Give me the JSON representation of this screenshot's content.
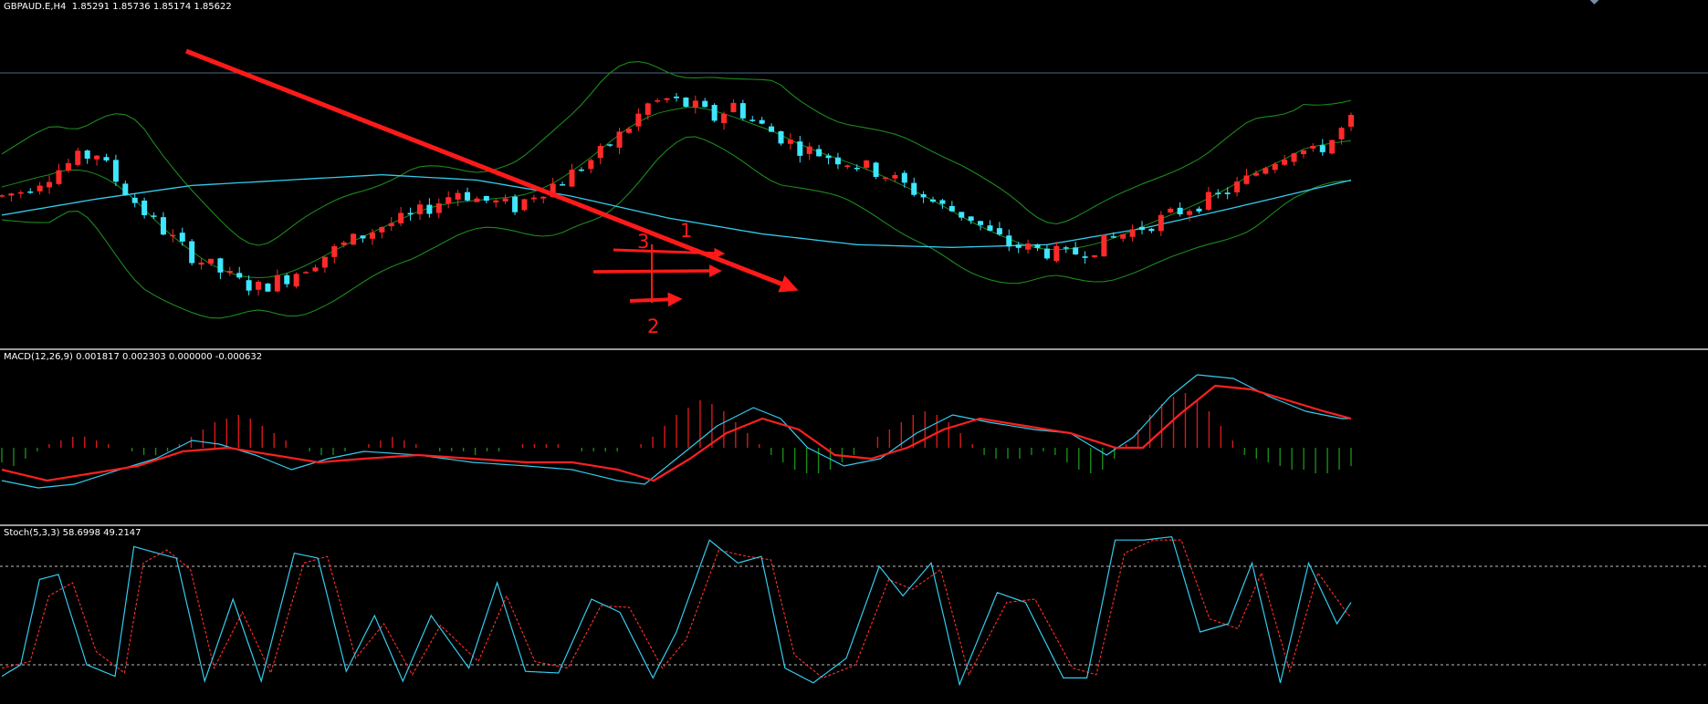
{
  "main_pane": {
    "label": "GBPAUD.E,H4  1.85291 1.85736 1.85174 1.85622",
    "annotations": [
      "1",
      "2",
      "3"
    ]
  },
  "macd_pane": {
    "label": "MACD(12,26,9) 0.001817 0.002303 0.000000 -0.000632"
  },
  "stoch_pane": {
    "label": "Stoch(5,3,3) 58.6998 49.2147",
    "levels": [
      80,
      20
    ]
  },
  "colors": {
    "bull": "#ff2a2a",
    "bear": "#3ee6ff",
    "ma": "#33ccee",
    "bands": "#1d8a1d",
    "trendline": "#ff1a1a",
    "macd_pos": "#d41a1a",
    "macd_neg": "#1a8a1a",
    "signal": "#ff2020",
    "stoch_main": "#33ccee",
    "stoch_signal": "#ff3030"
  },
  "chart_data": [
    {
      "type": "candlestick",
      "title": "GBPAUD.E,H4  1.85291 1.85736 1.85174 1.85622",
      "symbol": "GBPAUD.E",
      "timeframe": "H4",
      "last": {
        "open": 1.85291,
        "high": 1.85736,
        "low": 1.85174,
        "close": 1.85622
      },
      "close_path": [
        [
          0,
          0.44
        ],
        [
          4,
          0.46
        ],
        [
          10,
          0.52
        ],
        [
          16,
          0.58
        ],
        [
          20,
          0.6
        ],
        [
          24,
          0.5
        ],
        [
          30,
          0.38
        ],
        [
          36,
          0.28
        ],
        [
          40,
          0.22
        ],
        [
          46,
          0.16
        ],
        [
          50,
          0.12
        ],
        [
          54,
          0.1
        ],
        [
          60,
          0.14
        ],
        [
          66,
          0.2
        ],
        [
          72,
          0.26
        ],
        [
          80,
          0.33
        ],
        [
          86,
          0.36
        ],
        [
          90,
          0.4
        ],
        [
          96,
          0.46
        ],
        [
          100,
          0.43
        ],
        [
          108,
          0.4
        ],
        [
          112,
          0.45
        ],
        [
          118,
          0.5
        ],
        [
          126,
          0.6
        ],
        [
          132,
          0.7
        ],
        [
          136,
          0.78
        ],
        [
          140,
          0.8
        ],
        [
          146,
          0.77
        ],
        [
          150,
          0.73
        ],
        [
          154,
          0.78
        ],
        [
          158,
          0.72
        ],
        [
          162,
          0.68
        ],
        [
          168,
          0.62
        ],
        [
          174,
          0.59
        ],
        [
          180,
          0.56
        ],
        [
          186,
          0.52
        ],
        [
          192,
          0.46
        ],
        [
          198,
          0.4
        ],
        [
          204,
          0.36
        ],
        [
          208,
          0.3
        ],
        [
          212,
          0.26
        ],
        [
          218,
          0.24
        ],
        [
          224,
          0.22
        ],
        [
          230,
          0.25
        ],
        [
          236,
          0.3
        ],
        [
          242,
          0.34
        ],
        [
          250,
          0.4
        ],
        [
          256,
          0.44
        ],
        [
          262,
          0.5
        ],
        [
          266,
          0.56
        ],
        [
          272,
          0.62
        ],
        [
          276,
          0.6
        ],
        [
          280,
          0.65
        ],
        [
          284,
          0.72
        ]
      ],
      "moving_average": [
        [
          0,
          0.37
        ],
        [
          20,
          0.43
        ],
        [
          40,
          0.48
        ],
        [
          60,
          0.5
        ],
        [
          80,
          0.52
        ],
        [
          100,
          0.5
        ],
        [
          120,
          0.44
        ],
        [
          140,
          0.36
        ],
        [
          160,
          0.3
        ],
        [
          180,
          0.26
        ],
        [
          200,
          0.25
        ],
        [
          220,
          0.26
        ],
        [
          240,
          0.32
        ],
        [
          260,
          0.4
        ],
        [
          284,
          0.5
        ]
      ],
      "annotations": [
        "1",
        "2",
        "3"
      ]
    },
    {
      "type": "histogram+line",
      "title": "MACD(12,26,9) 0.001817 0.002303 0.000000 -0.000632",
      "params": [
        12,
        26,
        9
      ],
      "values": {
        "macd": 0.001817,
        "signal": 0.002303
      },
      "levels": [
        0.0,
        -0.000632
      ],
      "histogram": [
        -0.4,
        -0.5,
        -0.3,
        -0.1,
        0.1,
        0.2,
        0.3,
        0.3,
        0.2,
        0.1,
        0.0,
        -0.1,
        -0.2,
        -0.2,
        -0.1,
        0.1,
        0.3,
        0.5,
        0.7,
        0.8,
        0.9,
        0.8,
        0.6,
        0.4,
        0.2,
        0.0,
        -0.1,
        -0.2,
        -0.2,
        -0.1,
        0.0,
        0.1,
        0.2,
        0.3,
        0.2,
        0.1,
        0.0,
        -0.1,
        -0.1,
        -0.1,
        -0.2,
        -0.1,
        -0.1,
        0.0,
        0.1,
        0.1,
        0.1,
        0.1,
        0.0,
        -0.1,
        -0.1,
        -0.1,
        -0.1,
        0.0,
        0.1,
        0.3,
        0.6,
        0.9,
        1.1,
        1.3,
        1.2,
        1.0,
        0.7,
        0.4,
        0.1,
        -0.2,
        -0.4,
        -0.6,
        -0.7,
        -0.7,
        -0.6,
        -0.4,
        -0.2,
        0.0,
        0.3,
        0.5,
        0.7,
        0.9,
        1.0,
        0.9,
        0.7,
        0.4,
        0.1,
        -0.2,
        -0.3,
        -0.3,
        -0.3,
        -0.2,
        -0.1,
        -0.2,
        -0.4,
        -0.6,
        -0.7,
        -0.6,
        -0.3,
        0.1,
        0.5,
        0.9,
        1.2,
        1.4,
        1.5,
        1.3,
        1.0,
        0.6,
        0.2,
        -0.2,
        -0.3,
        -0.4,
        -0.5,
        -0.6,
        -0.6,
        -0.7,
        -0.7,
        -0.6,
        -0.5
      ],
      "macd_line": [
        [
          0,
          -0.9
        ],
        [
          8,
          -1.1
        ],
        [
          16,
          -1.0
        ],
        [
          26,
          -0.6
        ],
        [
          34,
          -0.3
        ],
        [
          42,
          0.2
        ],
        [
          48,
          0.1
        ],
        [
          56,
          -0.2
        ],
        [
          64,
          -0.6
        ],
        [
          72,
          -0.3
        ],
        [
          80,
          -0.1
        ],
        [
          92,
          -0.2
        ],
        [
          104,
          -0.4
        ],
        [
          116,
          -0.5
        ],
        [
          126,
          -0.6
        ],
        [
          136,
          -0.9
        ],
        [
          142,
          -1.0
        ],
        [
          150,
          -0.2
        ],
        [
          158,
          0.6
        ],
        [
          166,
          1.1
        ],
        [
          172,
          0.8
        ],
        [
          178,
          0.0
        ],
        [
          186,
          -0.5
        ],
        [
          194,
          -0.3
        ],
        [
          202,
          0.4
        ],
        [
          210,
          0.9
        ],
        [
          218,
          0.7
        ],
        [
          228,
          0.5
        ],
        [
          236,
          0.4
        ],
        [
          244,
          -0.2
        ],
        [
          250,
          0.3
        ],
        [
          258,
          1.4
        ],
        [
          264,
          2.0
        ],
        [
          272,
          1.9
        ],
        [
          280,
          1.4
        ],
        [
          288,
          1.0
        ],
        [
          296,
          0.8
        ]
      ],
      "signal_line": [
        [
          0,
          -0.6
        ],
        [
          10,
          -0.9
        ],
        [
          20,
          -0.7
        ],
        [
          30,
          -0.5
        ],
        [
          40,
          -0.1
        ],
        [
          50,
          0.0
        ],
        [
          60,
          -0.2
        ],
        [
          70,
          -0.4
        ],
        [
          80,
          -0.3
        ],
        [
          92,
          -0.2
        ],
        [
          104,
          -0.3
        ],
        [
          116,
          -0.4
        ],
        [
          126,
          -0.4
        ],
        [
          136,
          -0.6
        ],
        [
          144,
          -0.9
        ],
        [
          152,
          -0.3
        ],
        [
          160,
          0.4
        ],
        [
          168,
          0.8
        ],
        [
          176,
          0.5
        ],
        [
          184,
          -0.2
        ],
        [
          192,
          -0.3
        ],
        [
          200,
          0.0
        ],
        [
          208,
          0.5
        ],
        [
          216,
          0.8
        ],
        [
          226,
          0.6
        ],
        [
          236,
          0.4
        ],
        [
          246,
          0.0
        ],
        [
          252,
          0.0
        ],
        [
          260,
          0.9
        ],
        [
          268,
          1.7
        ],
        [
          276,
          1.6
        ],
        [
          284,
          1.3
        ],
        [
          292,
          1.0
        ],
        [
          298,
          0.8
        ]
      ]
    },
    {
      "type": "line",
      "title": "Stoch(5,3,3) 58.6998 49.2147",
      "params": [
        5,
        3,
        3
      ],
      "values": {
        "main": 58.6998,
        "signal": 49.2147
      },
      "levels": [
        80,
        20
      ],
      "ylim": [
        0,
        100
      ],
      "main_line": [
        [
          0,
          13
        ],
        [
          4,
          20
        ],
        [
          8,
          72
        ],
        [
          12,
          75
        ],
        [
          18,
          20
        ],
        [
          24,
          13
        ],
        [
          28,
          92
        ],
        [
          33,
          88
        ],
        [
          37,
          85
        ],
        [
          43,
          10
        ],
        [
          49,
          60
        ],
        [
          55,
          10
        ],
        [
          62,
          88
        ],
        [
          67,
          85
        ],
        [
          73,
          16
        ],
        [
          79,
          50
        ],
        [
          85,
          10
        ],
        [
          91,
          50
        ],
        [
          99,
          18
        ],
        [
          105,
          70
        ],
        [
          111,
          16
        ],
        [
          118,
          15
        ],
        [
          125,
          60
        ],
        [
          131,
          52
        ],
        [
          138,
          12
        ],
        [
          143,
          40
        ],
        [
          150,
          96
        ],
        [
          156,
          82
        ],
        [
          161,
          86
        ],
        [
          166,
          18
        ],
        [
          172,
          9
        ],
        [
          179,
          24
        ],
        [
          186,
          80
        ],
        [
          191,
          62
        ],
        [
          197,
          82
        ],
        [
          203,
          8
        ],
        [
          211,
          64
        ],
        [
          217,
          58
        ],
        [
          225,
          12
        ],
        [
          230,
          12
        ],
        [
          236,
          96
        ],
        [
          242,
          96
        ],
        [
          248,
          98
        ],
        [
          254,
          40
        ],
        [
          260,
          45
        ],
        [
          265,
          82
        ],
        [
          271,
          9
        ],
        [
          277,
          82
        ],
        [
          283,
          45
        ],
        [
          286,
          58
        ]
      ],
      "signal_line": [
        [
          0,
          18
        ],
        [
          6,
          22
        ],
        [
          10,
          62
        ],
        [
          15,
          70
        ],
        [
          20,
          28
        ],
        [
          26,
          15
        ],
        [
          30,
          82
        ],
        [
          35,
          90
        ],
        [
          40,
          78
        ],
        [
          45,
          18
        ],
        [
          51,
          52
        ],
        [
          57,
          15
        ],
        [
          64,
          82
        ],
        [
          69,
          86
        ],
        [
          75,
          24
        ],
        [
          81,
          45
        ],
        [
          87,
          14
        ],
        [
          93,
          44
        ],
        [
          101,
          22
        ],
        [
          107,
          62
        ],
        [
          113,
          22
        ],
        [
          120,
          18
        ],
        [
          127,
          56
        ],
        [
          133,
          55
        ],
        [
          140,
          18
        ],
        [
          145,
          35
        ],
        [
          152,
          90
        ],
        [
          158,
          86
        ],
        [
          163,
          84
        ],
        [
          168,
          26
        ],
        [
          174,
          12
        ],
        [
          181,
          20
        ],
        [
          188,
          72
        ],
        [
          193,
          66
        ],
        [
          199,
          78
        ],
        [
          205,
          14
        ],
        [
          213,
          58
        ],
        [
          219,
          60
        ],
        [
          227,
          18
        ],
        [
          232,
          14
        ],
        [
          238,
          88
        ],
        [
          244,
          96
        ],
        [
          250,
          96
        ],
        [
          256,
          48
        ],
        [
          262,
          42
        ],
        [
          267,
          76
        ],
        [
          273,
          16
        ],
        [
          279,
          76
        ],
        [
          285,
          52
        ],
        [
          286,
          49
        ]
      ]
    }
  ]
}
